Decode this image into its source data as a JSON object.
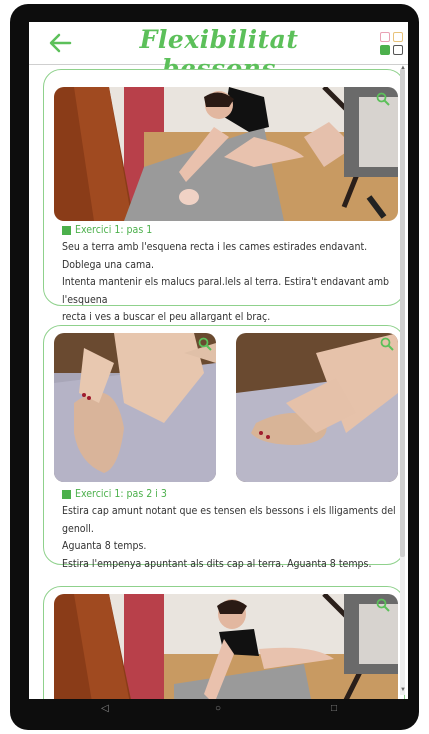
{
  "app": {
    "title": "Flexibilitat bessons"
  },
  "cards": [
    {
      "title": "Exercici 1: pas 1",
      "lines": [
        "Seu a terra amb l'esquena recta i les cames estirades endavant. Doblega una cama.",
        "Intenta mantenir els malucs paral.lels al terra. Estira't endavant amb l'esquena",
        "recta i ves a buscar el peu allargant el braç."
      ]
    },
    {
      "title": "Exercici 1: pas 2 i 3",
      "lines": [
        "Estira cap amunt notant que es tensen els bessons i els lligaments del genoll.",
        "Aguanta 8 temps.",
        "Estira l'empenya apuntant als dits cap al terra. Aguanta 8 temps."
      ]
    }
  ],
  "nav": {
    "back": "◁",
    "home": "○",
    "recent": "□"
  }
}
